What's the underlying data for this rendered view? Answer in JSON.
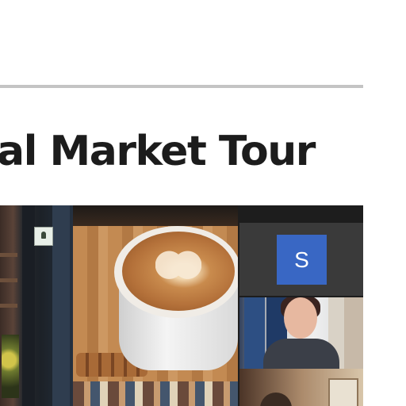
{
  "page": {
    "title": "al Market Tour"
  },
  "video_call": {
    "participants": [
      {
        "avatar_letter": "S",
        "avatar_color": "#3967c4"
      }
    ]
  },
  "colors": {
    "divider": "#c4c4c4",
    "title": "#1c1c1c",
    "stage_bg": "#1d1d1d"
  }
}
